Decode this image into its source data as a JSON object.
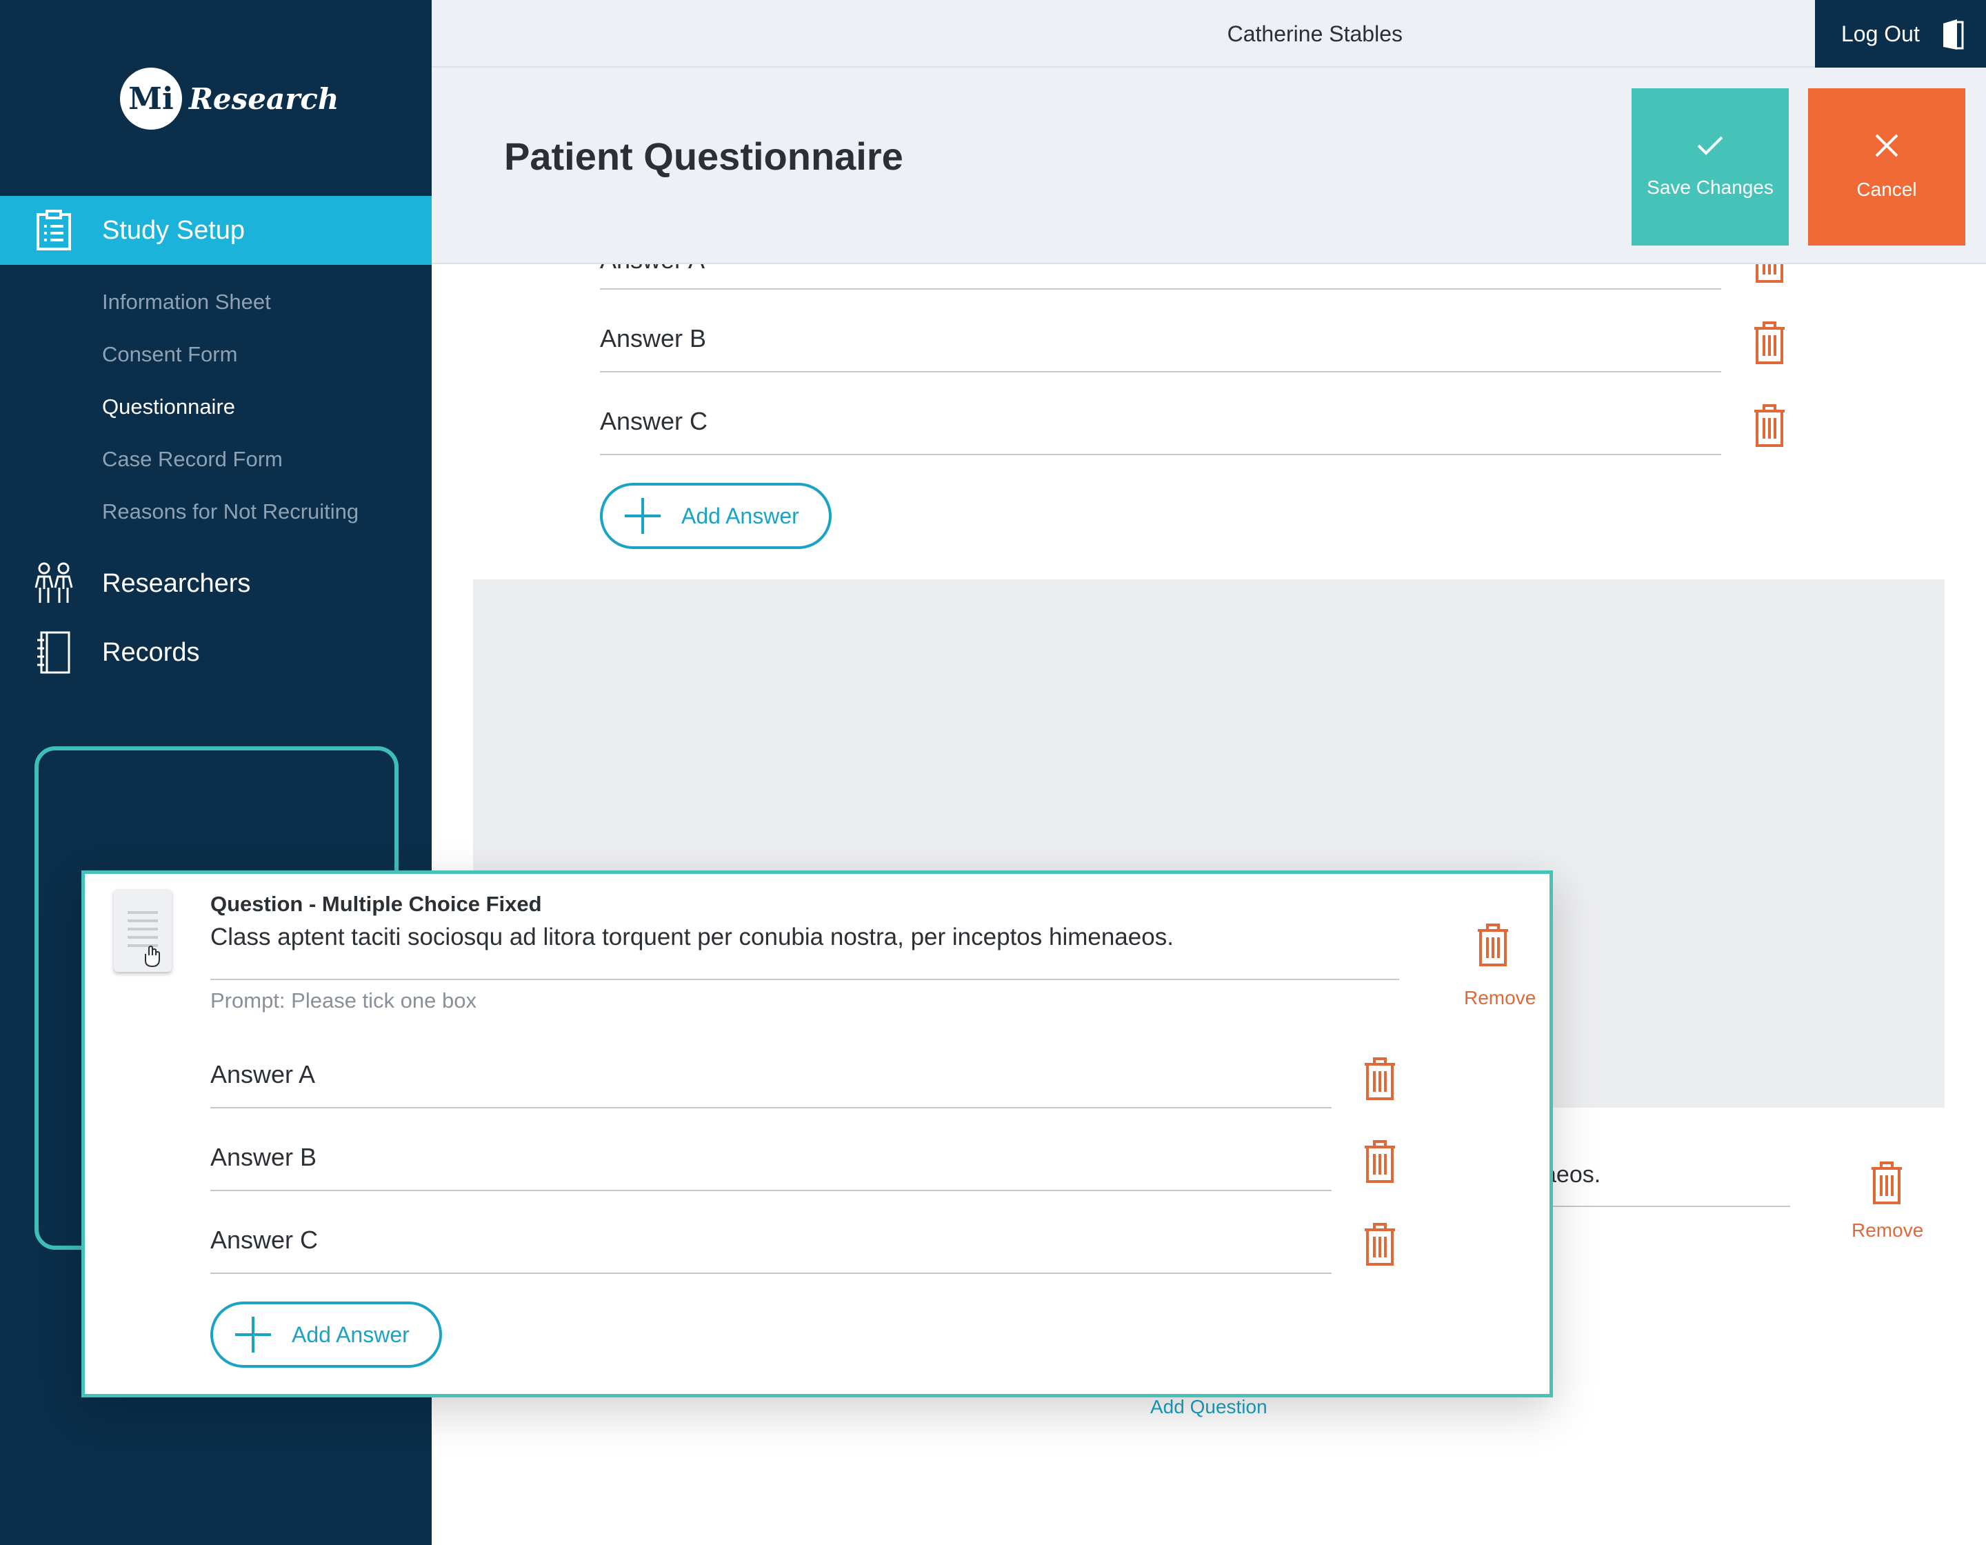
{
  "app": {
    "logo_mark": "Mi",
    "logo_word": "Research"
  },
  "user": {
    "name": "Catherine Stables",
    "logout_label": "Log Out"
  },
  "header": {
    "title": "Patient Questionnaire",
    "save_label": "Save Changes",
    "cancel_label": "Cancel"
  },
  "sidebar": {
    "study_setup": "Study Setup",
    "sub_items": [
      "Information Sheet",
      "Consent Form",
      "Questionnaire",
      "Case Record Form",
      "Reasons for Not Recruiting"
    ],
    "current_sub_item": "Questionnaire",
    "researchers": "Researchers",
    "records": "Records"
  },
  "background_question": {
    "partial_answer": "Answer A",
    "answers": [
      "Answer B",
      "Answer C"
    ],
    "add_answer_label": "Add Answer"
  },
  "next_question": {
    "partial_text": "aeos.",
    "remove_label": "Remove"
  },
  "add_question_label": "Add Question",
  "dragged_question": {
    "type_label": "Question - Multiple Choice Fixed",
    "text": "Class aptent taciti sociosqu ad litora torquent per conubia nostra, per inceptos himenaeos.",
    "prompt": "Prompt: Please tick one box",
    "remove_label": "Remove",
    "answers": [
      "Answer A",
      "Answer B",
      "Answer C"
    ],
    "add_answer_label": "Add Answer"
  },
  "colors": {
    "sidebar": "#0b2e4a",
    "active": "#1bb3d9",
    "teal": "#45c3b8",
    "orange": "#f06a37",
    "accent": "#1aa3c4"
  }
}
